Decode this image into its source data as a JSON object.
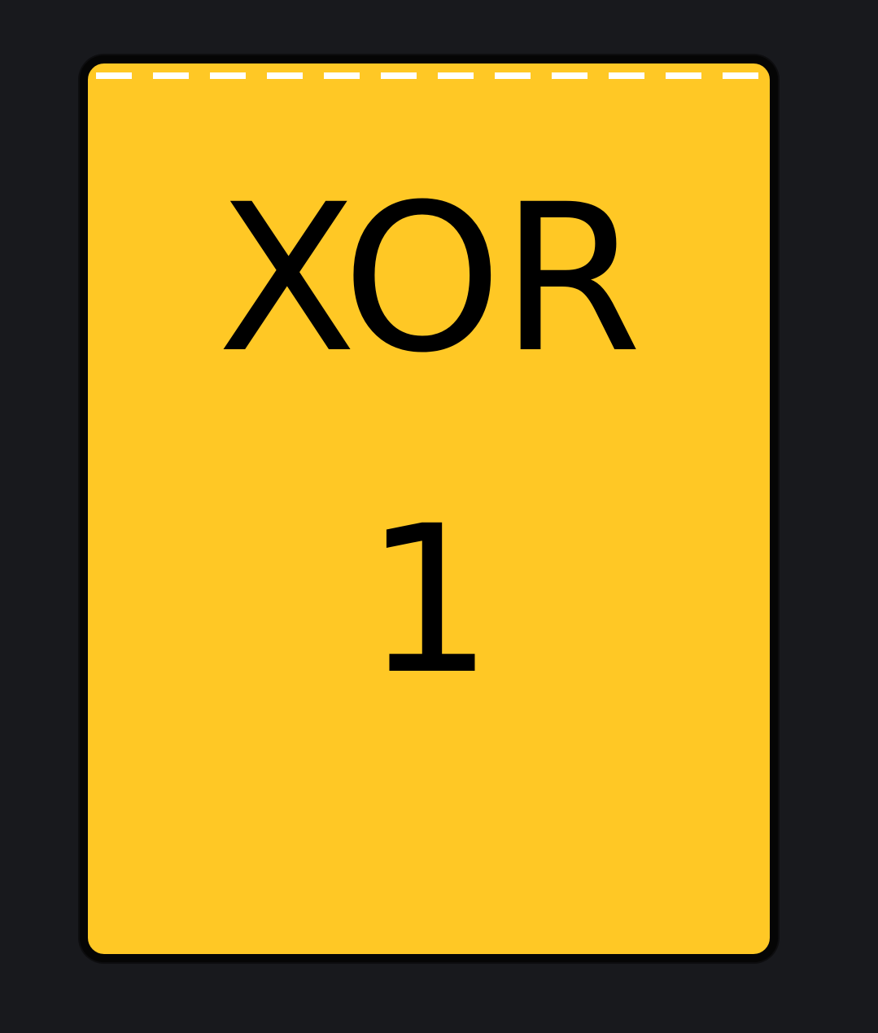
{
  "gate": {
    "label": "XOR",
    "output": "1"
  },
  "colors": {
    "background": "#18191d",
    "card_fill": "#ffc825",
    "card_border": "#050505",
    "selection_dash": "#ffffff",
    "text": "#000000"
  }
}
